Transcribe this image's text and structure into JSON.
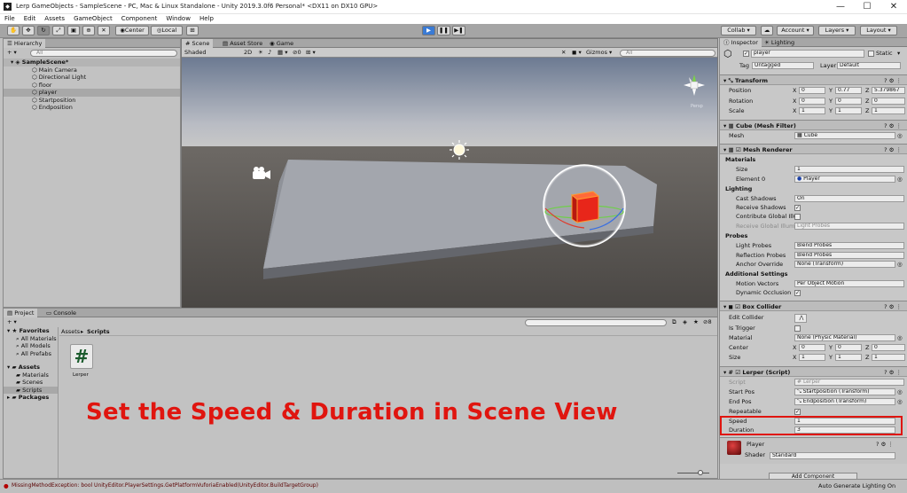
{
  "window": {
    "title": "Lerp GameObjects - SampleScene - PC, Mac & Linux Standalone - Unity 2019.3.0f6 Personal* <DX11 on DX10 GPU>",
    "icon": "unity-icon",
    "min": "—",
    "max": "☐",
    "close": "✕"
  },
  "menu": [
    "File",
    "Edit",
    "Assets",
    "GameObject",
    "Component",
    "Window",
    "Help"
  ],
  "toolbar": {
    "pivot": "Center",
    "space": "Local",
    "collab": "Collab ▾",
    "account": "Account ▾",
    "layers": "Layers ▾",
    "layout": "Layout ▾"
  },
  "hierarchy": {
    "tab": "Hierarchy",
    "add": "+ ▾",
    "search_placeholder": "All",
    "scene": "SampleScene*",
    "items": [
      "Main Camera",
      "Directional Light",
      "floor",
      "player",
      "Startposition",
      "Endposition"
    ]
  },
  "scene_view": {
    "tabs": [
      "Scene",
      "Asset Store",
      "Game"
    ],
    "shading": "Shaded",
    "mode2d": "2D",
    "gizmos": "Gizmos ▾",
    "search_placeholder": "All",
    "hidden_count": "0",
    "persp": "Persp"
  },
  "inspector": {
    "tabs": [
      "Inspector",
      "Lighting"
    ],
    "object_name": "player",
    "static": "Static",
    "tag_label": "Tag",
    "tag": "Untagged",
    "layer_label": "Layer",
    "layer": "Default",
    "transform": {
      "title": "Transform",
      "position_label": "Position",
      "position": [
        "0",
        "0.77",
        "5.379867"
      ],
      "rotation_label": "Rotation",
      "rotation": [
        "0",
        "0",
        "0"
      ],
      "scale_label": "Scale",
      "scale": [
        "1",
        "1",
        "1"
      ]
    },
    "mesh_filter": {
      "title": "Cube (Mesh Filter)",
      "mesh_label": "Mesh",
      "mesh": "Cube"
    },
    "mesh_renderer": {
      "title": "Mesh Renderer",
      "materials": "Materials",
      "size_label": "Size",
      "size": "1",
      "element0_label": "Element 0",
      "element0": "Player",
      "lighting": "Lighting",
      "cast_shadows_label": "Cast Shadows",
      "cast_shadows": "On",
      "receive_shadows_label": "Receive Shadows",
      "contribute_gi_label": "Contribute Global Illur",
      "receive_gi_label": "Receive Global Illumi",
      "receive_gi": "Light Probes",
      "probes": "Probes",
      "light_probes_label": "Light Probes",
      "light_probes": "Blend Probes",
      "reflection_probes_label": "Reflection Probes",
      "reflection_probes": "Blend Probes",
      "anchor_label": "Anchor Override",
      "anchor": "None (Transform)",
      "additional": "Additional Settings",
      "motion_label": "Motion Vectors",
      "motion": "Per Object Motion",
      "occlusion_label": "Dynamic Occlusion"
    },
    "box_collider": {
      "title": "Box Collider",
      "edit_label": "Edit Collider",
      "trigger_label": "Is Trigger",
      "material_label": "Material",
      "material": "None (Physic Material)",
      "center_label": "Center",
      "center": [
        "0",
        "0",
        "0"
      ],
      "size_label": "Size",
      "size": [
        "1",
        "1",
        "1"
      ]
    },
    "lerper": {
      "title": "Lerper (Script)",
      "script_label": "Script",
      "script": "Lerper",
      "start_label": "Start Pos",
      "start": "Startposition (Transform)",
      "end_label": "End Pos",
      "end": "Endposition (Transform)",
      "repeatable_label": "Repeatable",
      "speed_label": "Speed",
      "speed": "1",
      "duration_label": "Duration",
      "duration": "3"
    },
    "material": {
      "name": "Player",
      "shader_label": "Shader",
      "shader": "Standard"
    },
    "add_component": "Add Component"
  },
  "project": {
    "tabs": [
      "Project",
      "Console"
    ],
    "add": "+ ▾",
    "favorites": "Favorites",
    "fav_items": [
      "All Materials",
      "All Models",
      "All Prefabs"
    ],
    "assets": "Assets",
    "asset_items": [
      "Materials",
      "Scenes",
      "Scripts"
    ],
    "packages": "Packages",
    "breadcrumb": [
      "Assets",
      "Scripts"
    ],
    "file": "Lerper",
    "hidden_count": "8"
  },
  "status": {
    "error": "MissingMethodException: bool UnityEditor.PlayerSettings.GetPlatformVuforiaEnabled(UnityEditor.BuildTargetGroup)",
    "right": "Auto Generate Lighting On"
  },
  "overlay_text": "Set the Speed & Duration in Scene View",
  "colors": {
    "accent": "#e0150f",
    "play": "#3a7bd5"
  }
}
